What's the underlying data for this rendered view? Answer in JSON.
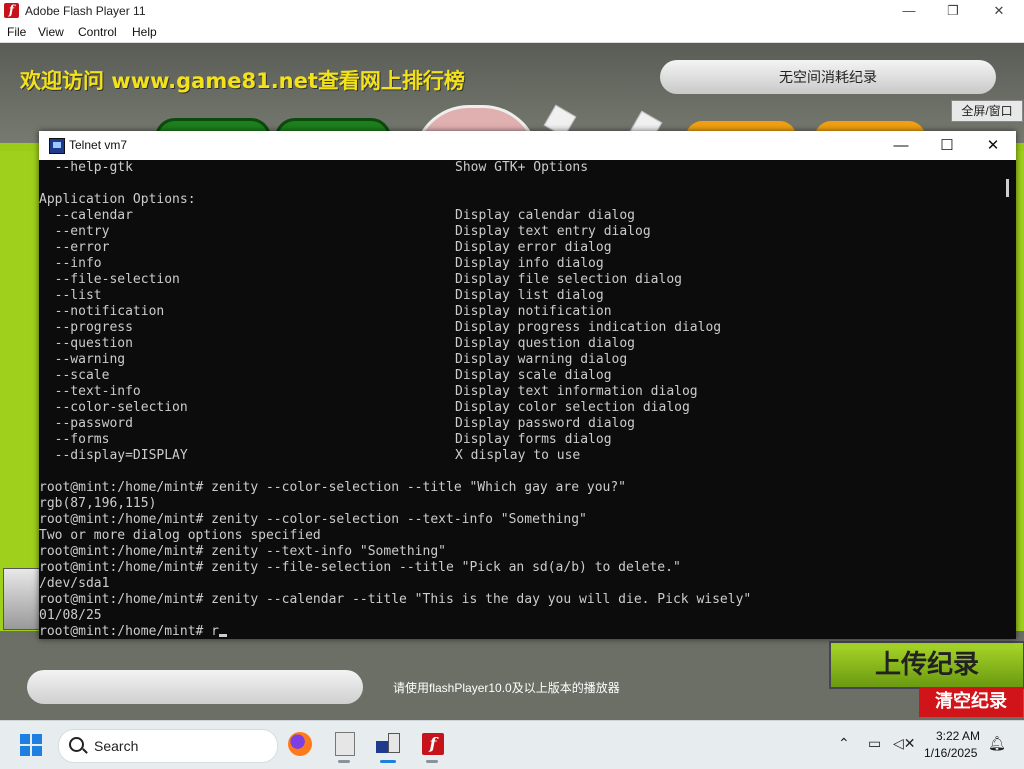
{
  "flash_window": {
    "title": "Adobe Flash Player 11",
    "controls": {
      "minimize": "—",
      "restore": "❐",
      "close": "✕"
    },
    "menu": [
      "File",
      "View",
      "Control",
      "Help"
    ]
  },
  "game": {
    "banner": "欢迎访问 www.game81.net查看网上排行榜",
    "record_status": "无空间消耗纪录",
    "fullscreen_toggle": "全屏/窗口",
    "bottom_note": "请使用flashPlayer10.0及以上版本的播放器",
    "upload_button": "上传纪录",
    "clear_button": "清空纪录"
  },
  "telnet": {
    "title": "Telnet vm7",
    "controls": {
      "minimize": "—",
      "maximize": "☐",
      "close": "✕"
    },
    "lines": [
      {
        "a": "  --help-gtk",
        "b": "Show GTK+ Options"
      },
      {
        "a": "",
        "b": ""
      },
      {
        "a": "Application Options:",
        "b": ""
      },
      {
        "a": "  --calendar",
        "b": "Display calendar dialog"
      },
      {
        "a": "  --entry",
        "b": "Display text entry dialog"
      },
      {
        "a": "  --error",
        "b": "Display error dialog"
      },
      {
        "a": "  --info",
        "b": "Display info dialog"
      },
      {
        "a": "  --file-selection",
        "b": "Display file selection dialog"
      },
      {
        "a": "  --list",
        "b": "Display list dialog"
      },
      {
        "a": "  --notification",
        "b": "Display notification"
      },
      {
        "a": "  --progress",
        "b": "Display progress indication dialog"
      },
      {
        "a": "  --question",
        "b": "Display question dialog"
      },
      {
        "a": "  --warning",
        "b": "Display warning dialog"
      },
      {
        "a": "  --scale",
        "b": "Display scale dialog"
      },
      {
        "a": "  --text-info",
        "b": "Display text information dialog"
      },
      {
        "a": "  --color-selection",
        "b": "Display color selection dialog"
      },
      {
        "a": "  --password",
        "b": "Display password dialog"
      },
      {
        "a": "  --forms",
        "b": "Display forms dialog"
      },
      {
        "a": "  --display=DISPLAY",
        "b": "X display to use"
      },
      {
        "a": "",
        "b": ""
      },
      {
        "a": "root@mint:/home/mint# zenity --color-selection --title \"Which gay are you?\"",
        "b": ""
      },
      {
        "a": "rgb(87,196,115)",
        "b": ""
      },
      {
        "a": "root@mint:/home/mint# zenity --color-selection --text-info \"Something\"",
        "b": ""
      },
      {
        "a": "Two or more dialog options specified",
        "b": ""
      },
      {
        "a": "root@mint:/home/mint# zenity --text-info \"Something\"",
        "b": ""
      },
      {
        "a": "root@mint:/home/mint# zenity --file-selection --title \"Pick an sd(a/b) to delete.\"",
        "b": ""
      },
      {
        "a": "/dev/sda1",
        "b": ""
      },
      {
        "a": "root@mint:/home/mint# zenity --calendar --title \"This is the day you will die. Pick wisely\"",
        "b": ""
      },
      {
        "a": "01/08/25",
        "b": ""
      }
    ],
    "prompt": "root@mint:/home/mint# r"
  },
  "taskbar": {
    "search_label": "Search",
    "apps": [
      "firefox-icon",
      "recorder-icon",
      "telnet-icon",
      "flash-player-icon"
    ],
    "time": "3:22 AM",
    "date": "1/16/2025",
    "accent": "#1f7fe0"
  }
}
